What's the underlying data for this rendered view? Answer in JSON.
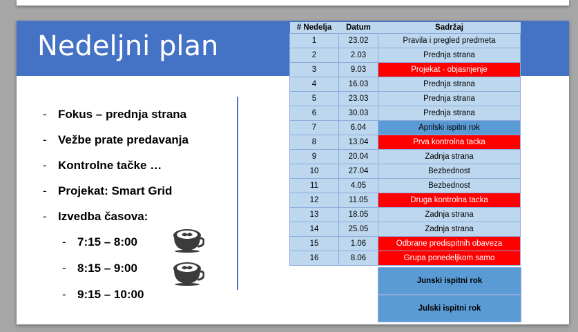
{
  "slide": {
    "title": "Nedeljni plan",
    "bullets": [
      "Fokus – prednja strana",
      "Vežbe prate predavanja",
      "Kontrolne tačke …",
      "Projekat: Smart Grid",
      "Izvedba časova:"
    ],
    "times": [
      "7:15 – 8:00",
      "8:15 – 9:00",
      "9:15 – 10:00"
    ],
    "dash": "-"
  },
  "schedule": {
    "headers": [
      "# Nedelja",
      "Datum",
      "Sadržaj"
    ],
    "rows": [
      {
        "week": "1",
        "date": "23.02",
        "content": "Pravila i pregled predmeta",
        "style": "normal"
      },
      {
        "week": "2",
        "date": "2.03",
        "content": "Prednja strana",
        "style": "normal"
      },
      {
        "week": "3",
        "date": "9.03",
        "content": "Projekat - objasnjenje",
        "style": "red"
      },
      {
        "week": "4",
        "date": "16.03",
        "content": "Prednja strana",
        "style": "normal"
      },
      {
        "week": "5",
        "date": "23.03",
        "content": "Prednja strana",
        "style": "normal"
      },
      {
        "week": "6",
        "date": "30.03",
        "content": "Prednja strana",
        "style": "normal"
      },
      {
        "week": "7",
        "date": "6.04",
        "content": "Aprilski ispitni rok",
        "style": "blue"
      },
      {
        "week": "8",
        "date": "13.04",
        "content": "Prva kontrolna tacka",
        "style": "red"
      },
      {
        "week": "9",
        "date": "20.04",
        "content": "Zadnja strana",
        "style": "normal"
      },
      {
        "week": "10",
        "date": "27.04",
        "content": "Bezbednost",
        "style": "normal"
      },
      {
        "week": "11",
        "date": "4.05",
        "content": "Bezbednost",
        "style": "normal"
      },
      {
        "week": "12",
        "date": "11.05",
        "content": "Druga kontrolna tacka",
        "style": "red"
      },
      {
        "week": "13",
        "date": "18.05",
        "content": "Zadnja strana",
        "style": "normal"
      },
      {
        "week": "14",
        "date": "25.05",
        "content": "Zadnja strana",
        "style": "normal"
      },
      {
        "week": "15",
        "date": "1.06",
        "content": "Odbrane predispitnih obaveza",
        "style": "red"
      },
      {
        "week": "16",
        "date": "8.06",
        "content": "Grupa ponedeljkom samo",
        "style": "red"
      }
    ],
    "exam_periods": [
      "Junski ispitni rok",
      "Julski ispitni rok"
    ]
  },
  "icons": [
    "coffee-cup-icon",
    "coffee-cup-icon"
  ],
  "colors": {
    "banner": "#4472c4",
    "table_light": "#bdd7ee",
    "table_highlight_blue": "#5b9bd5",
    "table_highlight_red": "#ff0000"
  }
}
